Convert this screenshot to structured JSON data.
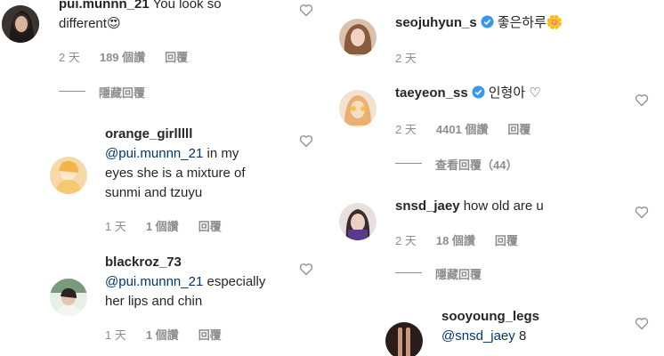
{
  "left": {
    "c1": {
      "username": "pui.munnn_21",
      "text_line1": "You look so",
      "text_line2": "different",
      "emoji": "😍",
      "time": "2 天",
      "likes": "189 個讚",
      "reply": "回覆"
    },
    "hide_replies": "隱藏回覆",
    "c2": {
      "username": "orange_girlllll",
      "mention": "@pui.munnn_21",
      "text_line1": " in my",
      "text_line2": "eyes she is a mixture of",
      "text_line3": "sunmi and tzuyu",
      "time": "1 天",
      "likes": "1 個讚",
      "reply": "回覆"
    },
    "c3": {
      "username": "blackroz_73",
      "mention": "@pui.munnn_21",
      "text_line1": " especially",
      "text_line2": "her lips and chin",
      "time": "1 天",
      "likes": "1 個讚",
      "reply": "回覆"
    }
  },
  "right": {
    "c1": {
      "username": "seojuhyun_s",
      "text": "좋은하루",
      "emoji": "🌼",
      "time": "2 天"
    },
    "c2": {
      "username": "taeyeon_ss",
      "text": "인형아 ♡",
      "time": "2 天",
      "likes": "4401 個讚",
      "reply": "回覆"
    },
    "view_replies": "查看回覆（44）",
    "c3": {
      "username": "snsd_jaey",
      "text": "how old are u",
      "time": "2 天",
      "likes": "18 個讚",
      "reply": "回覆"
    },
    "hide_replies": "隱藏回覆",
    "c4": {
      "username": "sooyoung_legs",
      "mention": "@snsd_jaey",
      "text": " 8"
    }
  },
  "colors": {
    "text": "#262626",
    "meta": "#8e8e8e",
    "mention": "#00376b",
    "verified": "#3897f0"
  },
  "icons": {
    "like": "heart-outline-icon",
    "verified": "verified-badge-icon"
  }
}
